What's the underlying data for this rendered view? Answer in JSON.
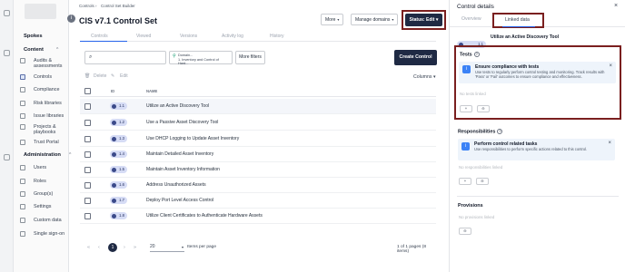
{
  "breadcrumb": {
    "root": "Controls",
    "sep": "›",
    "current": "Control Set Builder"
  },
  "page": {
    "title": "CIS v7.1 Control Set",
    "info_icon": "i"
  },
  "header_buttons": {
    "more": "More",
    "manage_domains": "Manage domains",
    "status": "Status: Edit",
    "dd": "▾"
  },
  "tabs": [
    "Controls",
    "Viewed",
    "Versions",
    "Activity log",
    "History"
  ],
  "sidebar": {
    "spokes": "Spokes",
    "content_head": "Content",
    "admin_head": "Administration",
    "chev": "^",
    "content_items": [
      "Audits & assessments",
      "Controls",
      "Compliance",
      "Risk libraries",
      "Issue libraries",
      "Projects & playbooks",
      "Trust Portal"
    ],
    "admin_items": [
      "Users",
      "Roles",
      "Group(s)",
      "Settings",
      "Custom data",
      "Single sign-on"
    ]
  },
  "toolbar": {
    "search_icon": "⌕",
    "filter_icon": "⚲",
    "filter_line1": "Domain...",
    "filter_line2": "1. Inventory and Control of Hard...",
    "more_filters": "More filters",
    "create": "Create Control"
  },
  "subbar": {
    "delete": "Delete",
    "edit": "Edit",
    "columns": "Columns",
    "dd": "▾"
  },
  "table": {
    "headers": [
      "ID",
      "NAME"
    ],
    "rows": [
      {
        "id": "1.1",
        "name": "Utilize an Active Discovery Tool"
      },
      {
        "id": "1.2",
        "name": "Use a Passive Asset Discovery Tool"
      },
      {
        "id": "1.3",
        "name": "Use DHCP Logging to Update Asset Inventory"
      },
      {
        "id": "1.4",
        "name": "Maintain Detailed Asset Inventory"
      },
      {
        "id": "1.5",
        "name": "Maintain Asset Inventory Information"
      },
      {
        "id": "1.6",
        "name": "Address Unauthorized Assets"
      },
      {
        "id": "1.7",
        "name": "Deploy Port Level Access Control"
      },
      {
        "id": "1.8",
        "name": "Utilize Client Certificates to Authenticate Hardware Assets"
      }
    ]
  },
  "pager": {
    "first": "«",
    "prev": "‹",
    "current": "1",
    "next": "›",
    "last": "»",
    "per_page": "20",
    "items_per_page": "Items per page",
    "count": "1 of 1 pages (8 items)",
    "dd": "▾"
  },
  "panel": {
    "title": "Control details",
    "close": "×",
    "tabs": [
      "Overview",
      "Linked data"
    ],
    "control_id": "1.1",
    "control_name": "Utilize an Active Discovery Tool",
    "tests": {
      "heading": "Tests",
      "card_title": "Ensure compliance with tests",
      "card_text": "Use tests to regularly perform control testing and monitoring. Track results with 'Pass' or 'Fail' outcomes to ensure compliance and effectiveness.",
      "empty": "No tests linked",
      "btn1": "+",
      "btn2": "⊖"
    },
    "responsibilities": {
      "heading": "Responsibilities",
      "card_title": "Perform control related tasks",
      "card_text": "Use responsibilities to perform specific actions related to this control.",
      "empty": "No responsibilities linked",
      "btn1": "+",
      "btn2": "⊖"
    },
    "provisions": {
      "heading": "Provisions",
      "empty": "No provisions linked",
      "btn": "⊖"
    },
    "info_icon": "i",
    "q": "?"
  }
}
